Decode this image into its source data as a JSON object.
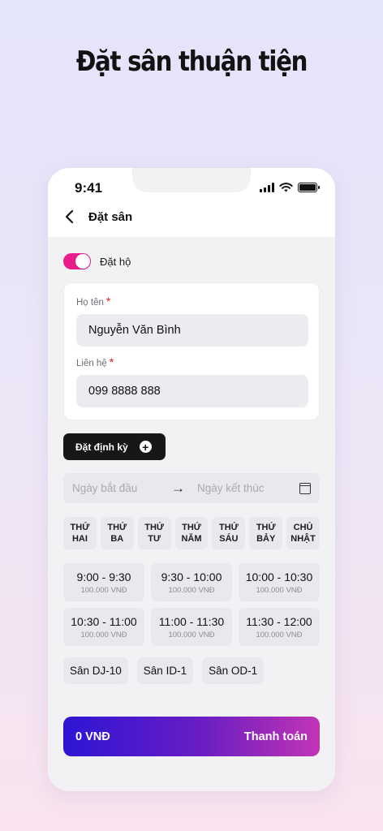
{
  "headline": "Đặt sân thuận tiện",
  "status_bar": {
    "time": "9:41"
  },
  "header": {
    "title": "Đặt sân"
  },
  "proxy_toggle": {
    "label": "Đặt hộ",
    "on": true
  },
  "form": {
    "name_label": "Họ tên",
    "name_value": "Nguyễn Văn Bình",
    "contact_label": "Liên hệ",
    "contact_value": "099 8888 888",
    "required_mark": "*"
  },
  "recurring_button": {
    "label": "Đặt định kỳ",
    "icon": "plus-circle-icon"
  },
  "date_range": {
    "start_placeholder": "Ngày bắt đầu",
    "arrow": "→",
    "end_placeholder": "Ngày kết thúc"
  },
  "weekdays": [
    {
      "line1": "THỨ",
      "line2": "HAI"
    },
    {
      "line1": "THỨ",
      "line2": "BA"
    },
    {
      "line1": "THỨ",
      "line2": "TƯ"
    },
    {
      "line1": "THỨ",
      "line2": "NĂM"
    },
    {
      "line1": "THỨ",
      "line2": "SÁU"
    },
    {
      "line1": "THỨ",
      "line2": "BẢY"
    },
    {
      "line1": "CHỦ",
      "line2": "NHẬT"
    }
  ],
  "time_slots": [
    {
      "range": "9:00 - 9:30",
      "price": "100.000 VNĐ"
    },
    {
      "range": "9:30 - 10:00",
      "price": "100.000 VNĐ"
    },
    {
      "range": "10:00 - 10:30",
      "price": "100.000 VNĐ"
    },
    {
      "range": "10:30 - 11:00",
      "price": "100.000 VNĐ"
    },
    {
      "range": "11:00 - 11:30",
      "price": "100.000 VNĐ"
    },
    {
      "range": "11:30 - 12:00",
      "price": "100.000 VNĐ"
    }
  ],
  "courts": [
    "Sân DJ-10",
    "Sân ID-1",
    "Sân OD-1"
  ],
  "payment": {
    "total": "0 VNĐ",
    "button_label": "Thanh toán"
  },
  "colors": {
    "toggle_on": "#e91e8c",
    "required": "#e02020",
    "pay_gradient_start": "#2d15d4",
    "pay_gradient_end": "#c234b4"
  }
}
